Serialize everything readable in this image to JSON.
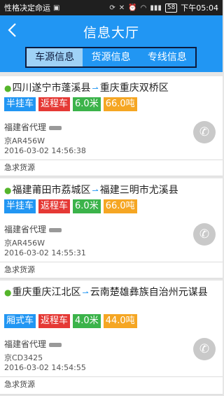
{
  "status_bar": {
    "app_notice": "性格决定命运",
    "battery": "58",
    "time": "下午05:04"
  },
  "header": {
    "title": "信息大厅",
    "tabs": [
      "车源信息",
      "货源信息",
      "专线信息"
    ]
  },
  "colors": {
    "primary": "#2196f3",
    "tag_blue": "#2196f3",
    "tag_red": "#e53935",
    "tag_green": "#3bb34a",
    "tag_orange": "#f5a623"
  },
  "listings": [
    {
      "origin": "四川遂宁市蓬溪县",
      "destination": "重庆重庆双桥区",
      "tags": [
        "半挂车",
        "返程车",
        "6.0米",
        "66.0吨"
      ],
      "agent": "福建省代理",
      "plate": "京AR456W",
      "time": "2016-03-02 14:56:38",
      "note": "急求货源"
    },
    {
      "origin": "福建莆田市荔城区",
      "destination": "福建三明市尤溪县",
      "tags": [
        "半挂车",
        "返程车",
        "6.0米",
        "66.0吨"
      ],
      "agent": "福建省代理",
      "plate": "京AR456W",
      "time": "2016-03-02 14:55:31",
      "note": "急求货源"
    },
    {
      "origin": "重庆重庆江北区",
      "destination": "云南楚雄彝族自治州元谋县",
      "tags": [
        "厢式车",
        "返程车",
        "4.0米",
        "44.0吨"
      ],
      "agent": "福建省代理",
      "plate": "京CD3425",
      "time": "2016-03-02 14:54:55",
      "note": "急求货源"
    }
  ]
}
